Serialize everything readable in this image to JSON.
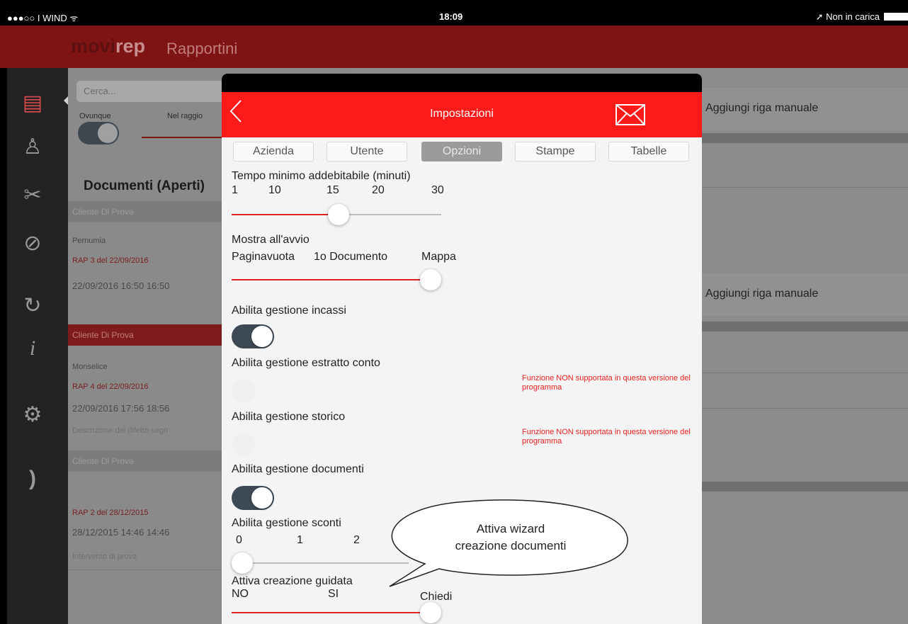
{
  "status_bar": {
    "carrier": "●●●○○ I WIND ᯤ",
    "time": "18:09",
    "charging": "➚ Non in carica"
  },
  "app": {
    "logo_part1": "movi",
    "logo_part2": "rep",
    "title": "Rapportini"
  },
  "sidebar": {
    "items": [
      {
        "icon": "report-icon",
        "glyph": "▤"
      },
      {
        "icon": "person-icon",
        "glyph": "♙"
      },
      {
        "icon": "tools-icon",
        "glyph": "✂"
      },
      {
        "icon": "attachment-icon",
        "glyph": "⊘"
      },
      {
        "icon": "sync-icon",
        "glyph": "↻"
      },
      {
        "icon": "info-icon",
        "glyph": "i"
      },
      {
        "icon": "gear-icon",
        "glyph": "⚙"
      },
      {
        "icon": "logout-icon",
        "glyph": ")"
      }
    ]
  },
  "list": {
    "search_placeholder": "Cerca...",
    "scope_anywhere": "Ovunque",
    "scope_radius": "Nel raggio",
    "section_title": "Documenti (Aperti)",
    "groups": [
      {
        "client": "Cliente Di Prova",
        "place": "Pernumia",
        "rap": "RAP 3 del 22/09/2016",
        "date": "22/09/2016  16:50  16:50"
      },
      {
        "client": "Cliente Di Prova",
        "place": "Monselice",
        "rap": "RAP 4 del 22/09/2016",
        "date": "22/09/2016  17:56  18:56",
        "desc": "Descrizione del difetto segn"
      },
      {
        "client": "Cliente Di Prova",
        "rap": "RAP 2 del 28/12/2015",
        "date": "28/12/2015  14:46  14:46",
        "desc": "Intervento di prova"
      }
    ]
  },
  "right_pane": {
    "row1": "Aggiungi riga manuale",
    "row2": "Aggiungi riga manuale"
  },
  "modal": {
    "title": "Impostazioni",
    "tabs": [
      "Azienda",
      "Utente",
      "Opzioni",
      "Stampe",
      "Tabelle"
    ],
    "selected_tab": "Opzioni",
    "settings": {
      "min_time": {
        "label": "Tempo minimo addebitabile (minuti)",
        "ticks": [
          "1",
          "10",
          "15",
          "20",
          "30"
        ],
        "value": "15"
      },
      "startup": {
        "label": "Mostra all'avvio",
        "ticks": [
          "Paginavuota",
          "1o Documento",
          "Mappa"
        ],
        "value": "Mappa"
      },
      "incassi": {
        "label": "Abilita gestione incassi",
        "on": true
      },
      "estratto_conto": {
        "label": "Abilita gestione estratto conto",
        "on": false,
        "warning": "Funzione NON supportata in questa versione del programma"
      },
      "storico": {
        "label": "Abilita gestione storico",
        "on": false,
        "warning": "Funzione NON supportata in questa versione del programma"
      },
      "documenti": {
        "label": "Abilita gestione documenti",
        "on": true
      },
      "sconti": {
        "label": "Abilita gestione sconti",
        "ticks": [
          "0",
          "1",
          "2"
        ],
        "value": "0"
      },
      "guidata": {
        "label": "Attiva creazione guidata",
        "ticks": [
          "NO",
          "SI",
          "Chiedi"
        ],
        "value": "Chiedi"
      }
    }
  },
  "callout": {
    "line1": "Attiva wizard",
    "line2": "creazione documenti"
  },
  "colors": {
    "accent": "#ff1a1a",
    "header_bg": "#7e1414",
    "toggle_on": "#3d4954",
    "warning": "#e82020"
  }
}
